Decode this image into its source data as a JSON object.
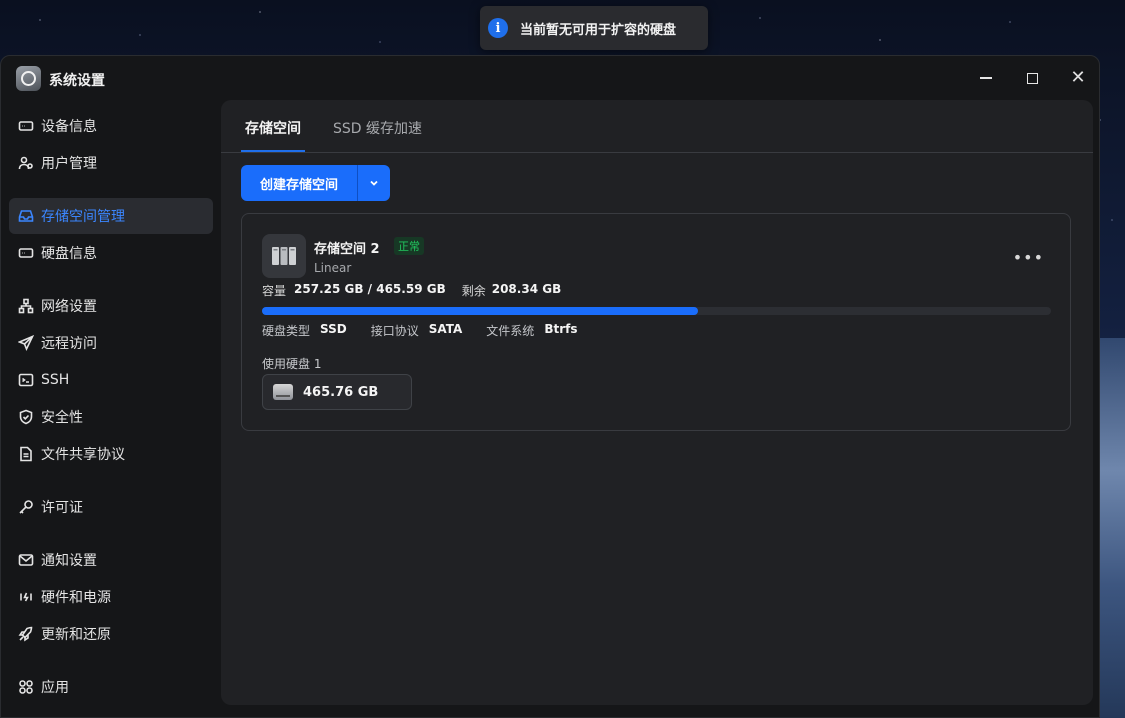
{
  "toast": {
    "icon": "info-icon",
    "message": "当前暂无可用于扩容的硬盘",
    "accent": "#1f6feb"
  },
  "window": {
    "title": "系统设置",
    "controls": [
      "minimize-icon",
      "maximize-icon",
      "close-icon"
    ]
  },
  "sidebar": {
    "items": [
      {
        "label": "设备信息",
        "icon": "device-icon",
        "active": false
      },
      {
        "label": "用户管理",
        "icon": "users-icon",
        "active": false
      },
      {
        "label": "存储空间管理",
        "icon": "storage-icon",
        "active": true
      },
      {
        "label": "硬盘信息",
        "icon": "disk-icon",
        "active": false
      },
      {
        "label": "网络设置",
        "icon": "network-icon",
        "active": false
      },
      {
        "label": "远程访问",
        "icon": "send-icon",
        "active": false
      },
      {
        "label": "SSH",
        "icon": "terminal-icon",
        "active": false
      },
      {
        "label": "安全性",
        "icon": "shield-icon",
        "active": false
      },
      {
        "label": "文件共享协议",
        "icon": "document-icon",
        "active": false
      },
      {
        "label": "许可证",
        "icon": "key-icon",
        "active": false
      },
      {
        "label": "通知设置",
        "icon": "mail-icon",
        "active": false
      },
      {
        "label": "硬件和电源",
        "icon": "power-icon",
        "active": false
      },
      {
        "label": "更新和还原",
        "icon": "rocket-icon",
        "active": false
      },
      {
        "label": "应用",
        "icon": "apps-icon",
        "active": false
      }
    ]
  },
  "main": {
    "tabs": [
      {
        "label": "存储空间",
        "active": true
      },
      {
        "label": "SSD 缓存加速",
        "active": false
      }
    ],
    "create_button": "创建存储空间",
    "pool": {
      "name": "存储空间 2",
      "status": "正常",
      "type": "Linear",
      "capacity_label": "容量",
      "capacity_value": "257.25 GB / 465.59 GB",
      "remaining_label": "剩余",
      "remaining_value": "208.34 GB",
      "usage_fraction": 0.5525,
      "disk_type_label": "硬盘类型",
      "disk_type_value": "SSD",
      "interface_label": "接口协议",
      "interface_value": "SATA",
      "fs_label": "文件系统",
      "fs_value": "Btrfs",
      "used_disks_label": "使用硬盘 1",
      "disk_size": "465.76 GB"
    }
  },
  "colors": {
    "accent": "#1a6dfb",
    "status_ok": "#22c55e",
    "active_nav": "#3b86ff"
  }
}
